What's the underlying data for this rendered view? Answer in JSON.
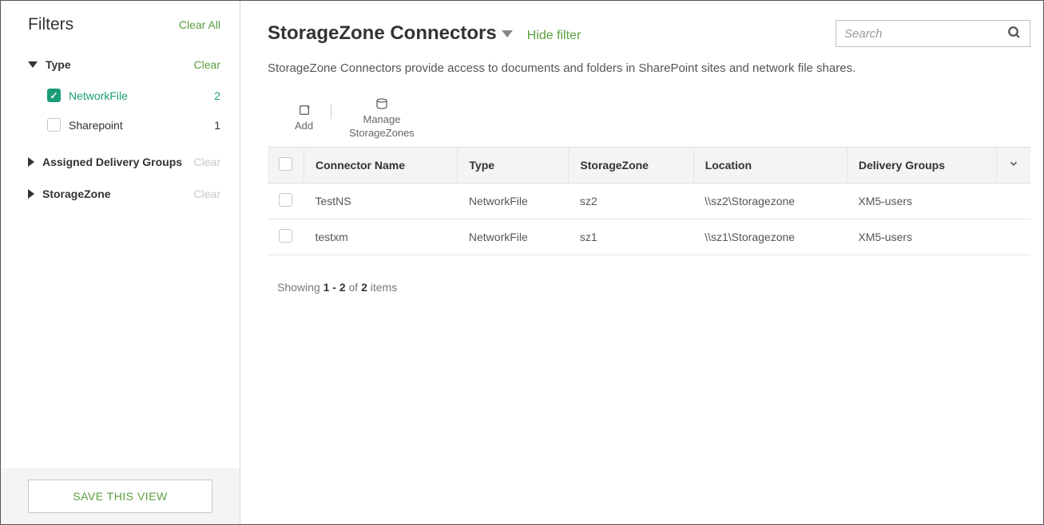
{
  "sidebar": {
    "title": "Filters",
    "clear_all": "Clear All",
    "groups": [
      {
        "name": "Type",
        "clear": "Clear",
        "clear_active": true,
        "expanded": true,
        "items": [
          {
            "label": "NetworkFile",
            "count": 2,
            "checked": true
          },
          {
            "label": "Sharepoint",
            "count": 1,
            "checked": false
          }
        ]
      },
      {
        "name": "Assigned Delivery Groups",
        "clear": "Clear",
        "clear_active": false,
        "expanded": false
      },
      {
        "name": "StorageZone",
        "clear": "Clear",
        "clear_active": false,
        "expanded": false
      }
    ],
    "save_button": "SAVE THIS VIEW"
  },
  "header": {
    "title": "StorageZone Connectors",
    "hide_filter": "Hide filter",
    "search_placeholder": "Search"
  },
  "description": "StorageZone Connectors provide access to documents and folders in SharePoint sites and network file shares.",
  "toolbar": {
    "add": "Add",
    "manage": "Manage\nStorageZones"
  },
  "table": {
    "columns": [
      "Connector Name",
      "Type",
      "StorageZone",
      "Location",
      "Delivery Groups"
    ],
    "rows": [
      {
        "name": "TestNS",
        "type": "NetworkFile",
        "zone": "sz2",
        "location": "\\\\sz2\\Storagezone",
        "groups": "XM5-users"
      },
      {
        "name": "testxm",
        "type": "NetworkFile",
        "zone": "sz1",
        "location": "\\\\sz1\\Storagezone",
        "groups": "XM5-users"
      }
    ]
  },
  "pagination": {
    "prefix": "Showing ",
    "range": "1 - 2",
    "middle": " of ",
    "total": "2",
    "suffix": " items"
  }
}
